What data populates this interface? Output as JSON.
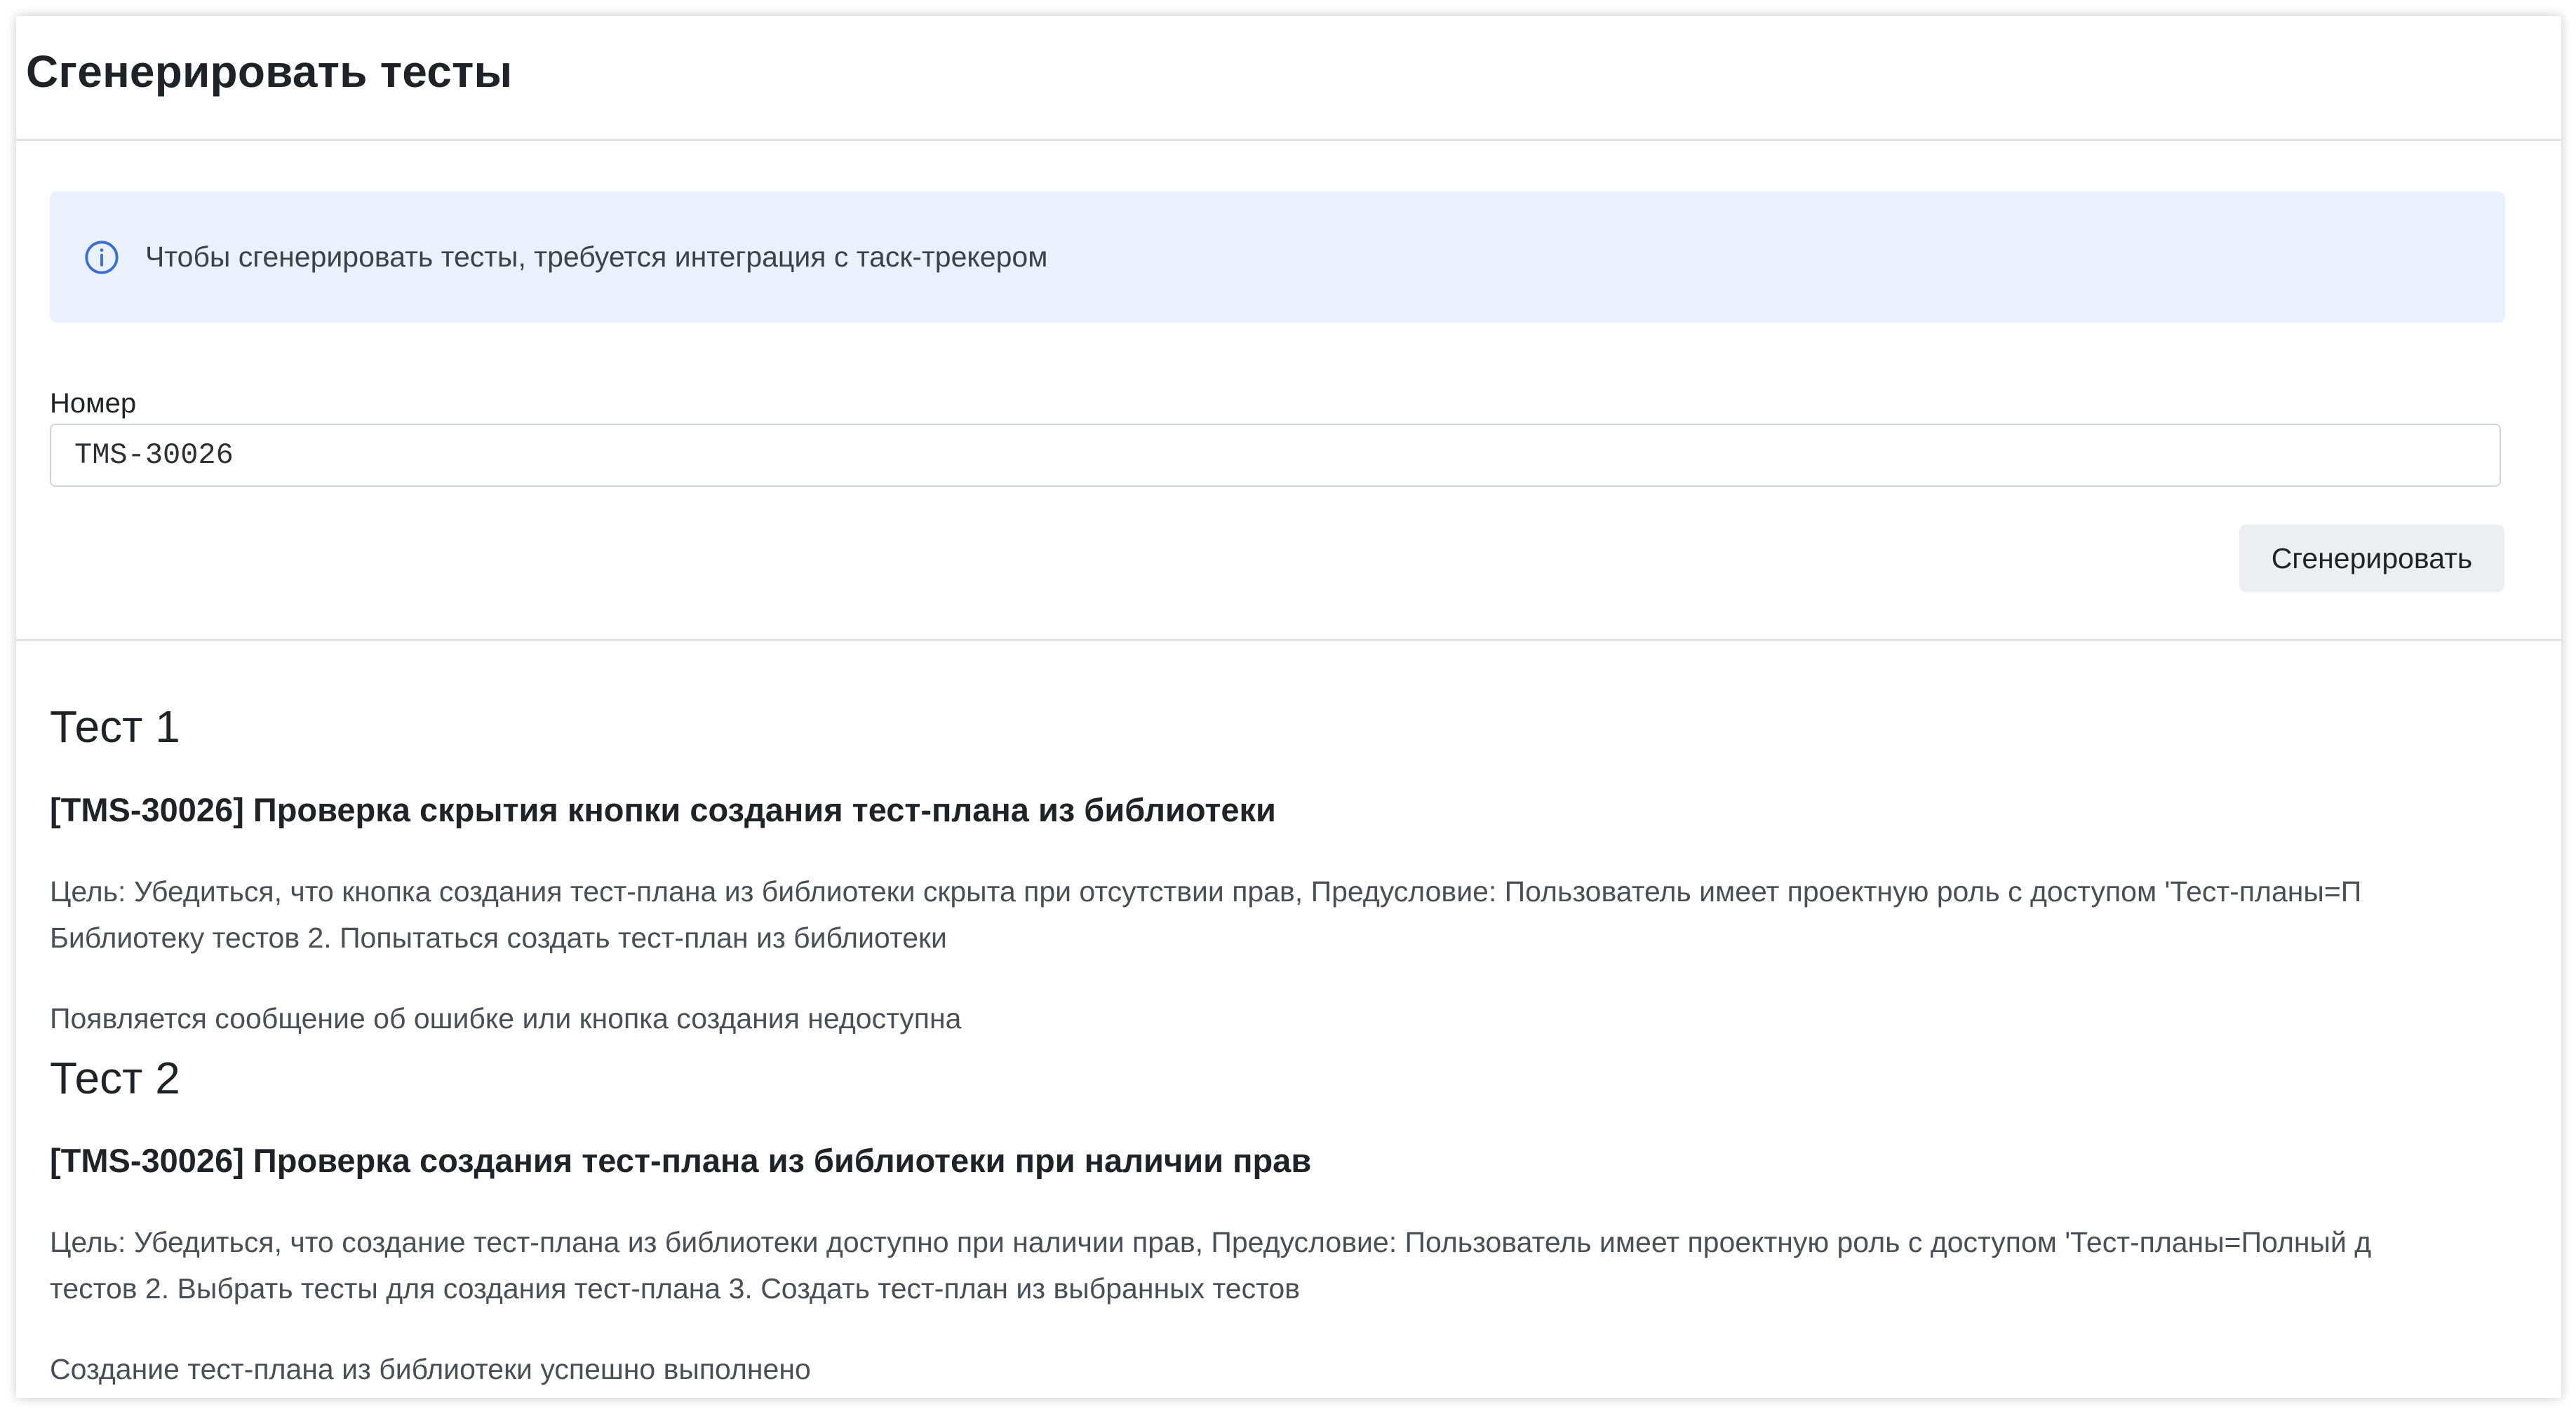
{
  "header": {
    "title": "Сгенерировать тесты"
  },
  "alert": {
    "icon": "info-icon",
    "text": "Чтобы сгенерировать тесты, требуется интеграция с таск-трекером"
  },
  "form": {
    "number_label": "Номер",
    "number_value": "TMS-30026",
    "generate_label": "Сгенерировать"
  },
  "tests": [
    {
      "heading": "Тест 1",
      "title": "[TMS-30026] Проверка скрытия кнопки создания тест-плана из библиотеки",
      "desc_line1": "Цель: Убедиться, что кнопка создания тест-плана из библиотеки скрыта при отсутствии прав, Предусловие: Пользователь имеет проектную роль с доступом 'Тест-планы=П",
      "desc_line2": "Библиотеку тестов 2. Попытаться создать тест-план из библиотеки",
      "expected": "Появляется сообщение об ошибке или кнопка создания недоступна"
    },
    {
      "heading": "Тест 2",
      "title": "[TMS-30026] Проверка создания тест-плана из библиотеки при наличии прав",
      "desc_line1": "Цель: Убедиться, что создание тест-плана из библиотеки доступно при наличии прав, Предусловие: Пользователь имеет проектную роль с доступом 'Тест-планы=Полный д",
      "desc_line2": "тестов 2. Выбрать тесты для создания тест-плана 3. Создать тест-план из выбранных тестов",
      "expected": "Создание тест-плана из библиотеки успешно выполнено"
    }
  ],
  "colors": {
    "alert_bg": "#eaf1fc",
    "info_icon": "#3b6fd4",
    "button_bg": "#eceef1"
  }
}
